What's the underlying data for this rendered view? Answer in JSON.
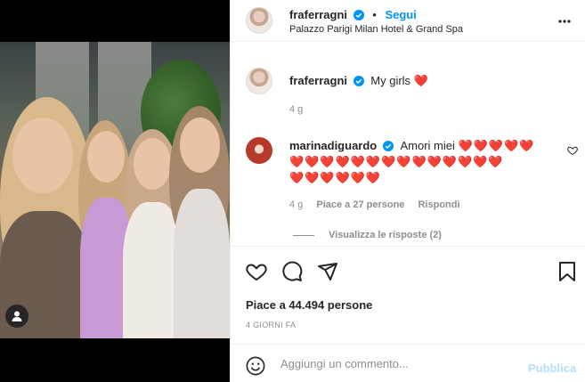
{
  "post": {
    "username": "fraferragni",
    "follow_label": "Segui",
    "separator": "•",
    "location": "Palazzo Parigi Milan Hotel & Grand Spa",
    "more_icon": "ellipsis-vertical-icon"
  },
  "caption": {
    "username": "fraferragni",
    "text": "My girls",
    "emoji": "❤️",
    "time": "4 g"
  },
  "comment": {
    "username": "marinadiguardo",
    "text": "Amori miei",
    "hearts_line1": "❤️❤️❤️❤️❤️",
    "hearts_line2": "❤️❤️❤️❤️❤️❤️❤️❤️❤️❤️❤️❤️❤️❤️",
    "hearts_line3": "❤️❤️❤️❤️❤️❤️",
    "time": "4 g",
    "likes": "Piace a 27 persone",
    "reply_label": "Rispondi",
    "view_replies": "Visualizza le risposte (2)"
  },
  "actions": {
    "likes_text": "Piace a 44.494 persone",
    "date": "4 GIORNI FA"
  },
  "add_comment": {
    "placeholder": "Aggiungi un commento...",
    "publish_label": "Pubblica"
  },
  "colors": {
    "accent": "#0095f6",
    "heart": "#ed4956",
    "publish_disabled": "#b2dffc",
    "muted": "#8e8e8e"
  }
}
